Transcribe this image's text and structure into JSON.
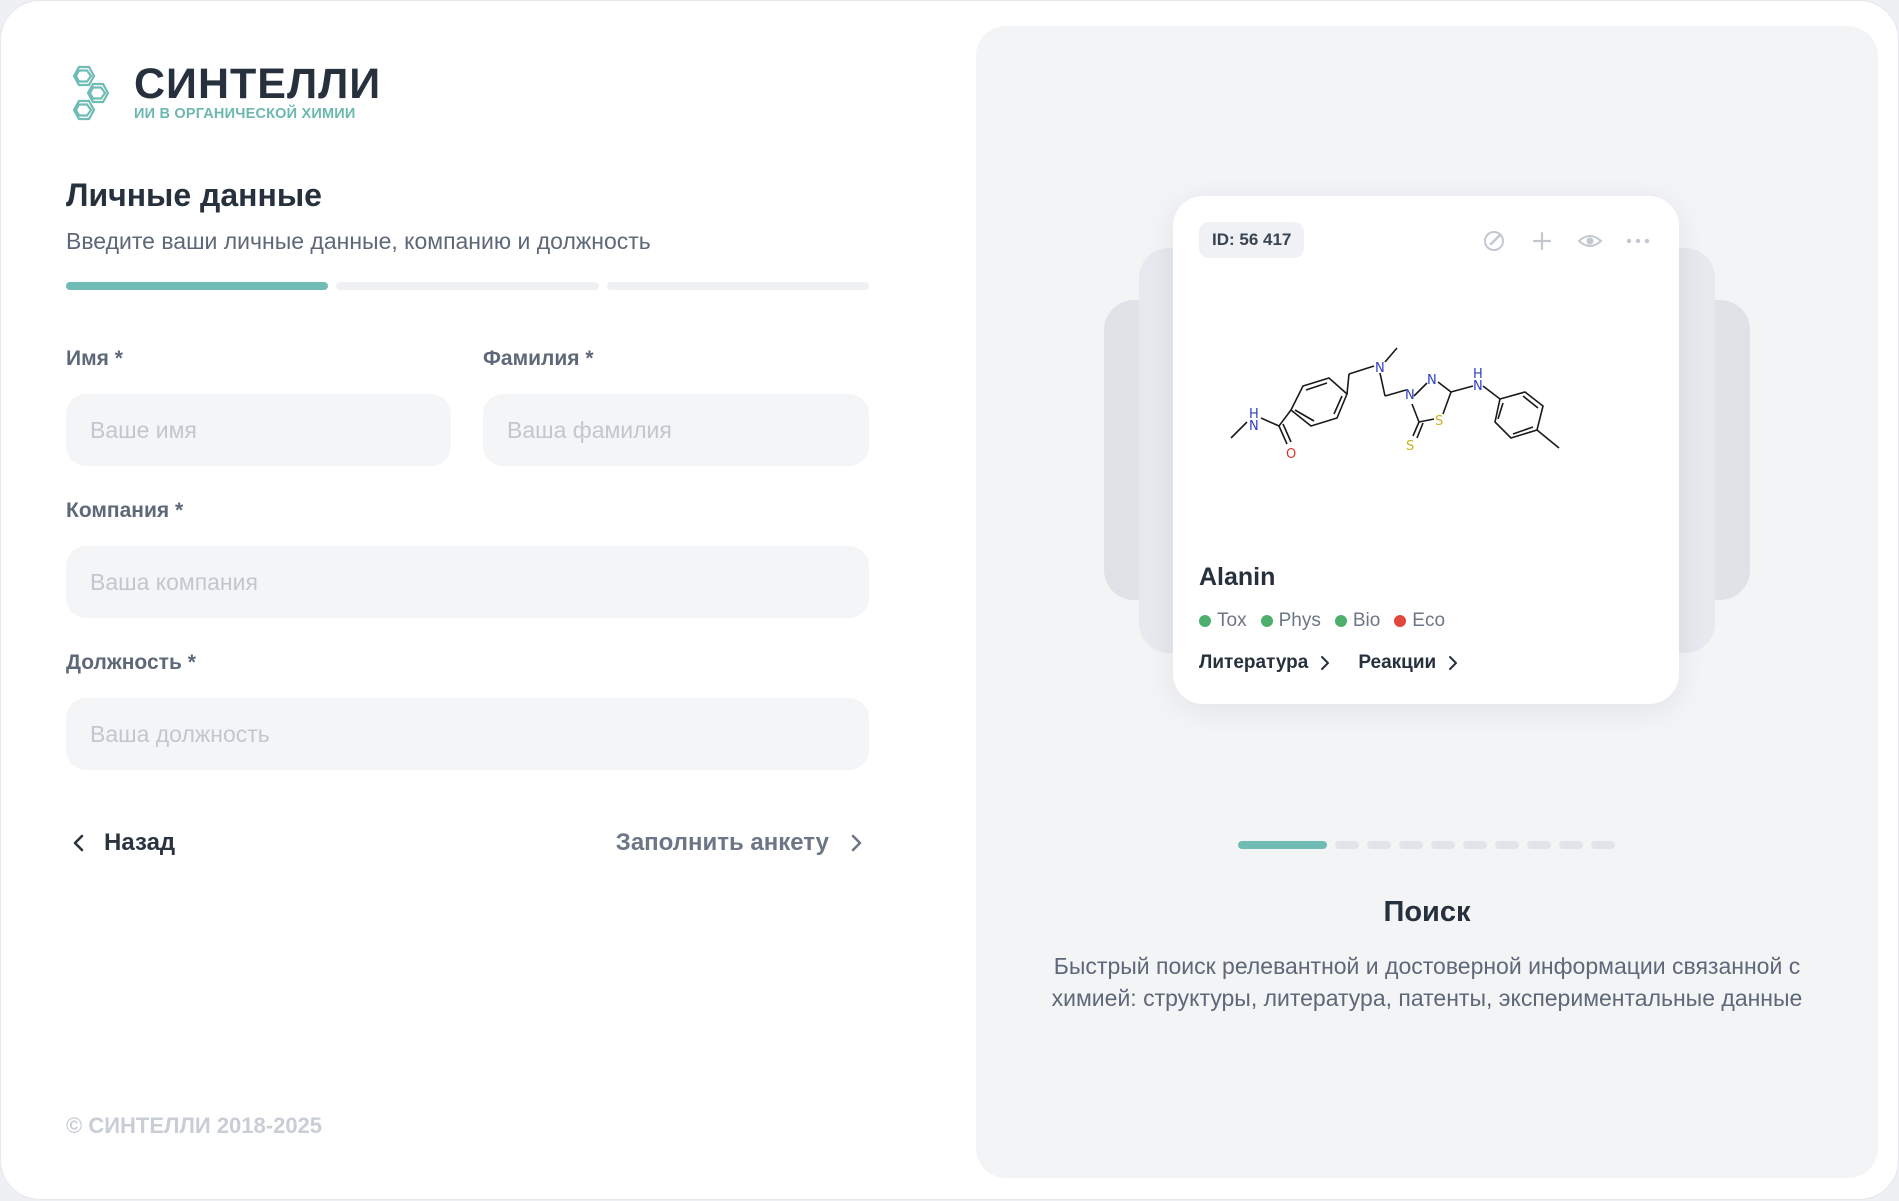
{
  "brand": {
    "name": "СИНТЕЛЛИ",
    "tagline": "ИИ В ОРГАНИЧЕСКОЙ ХИМИИ",
    "accent_color": "#6fbcb5"
  },
  "form": {
    "title": "Личные данные",
    "subtitle": "Введите ваши личные данные, компанию и должность",
    "step_progress": {
      "current": 1,
      "total": 3
    },
    "fields": {
      "first_name": {
        "label": "Имя *",
        "placeholder": "Ваше имя",
        "value": ""
      },
      "last_name": {
        "label": "Фамилия *",
        "placeholder": "Ваша фамилия",
        "value": ""
      },
      "company": {
        "label": "Компания *",
        "placeholder": "Ваша компания",
        "value": ""
      },
      "position": {
        "label": "Должность *",
        "placeholder": "Ваша должность",
        "value": ""
      }
    },
    "back_label": "Назад",
    "next_label": "Заполнить анкету"
  },
  "footer": {
    "copyright": "© СИНТЕЛЛИ 2018-2025"
  },
  "showcase": {
    "card": {
      "id_label": "ID: 56 417",
      "actions": [
        "edit-icon",
        "plus-icon",
        "eye-icon",
        "more-icon"
      ],
      "name": "Alanin",
      "badges": [
        {
          "label": "Tox",
          "color": "#4caf6e"
        },
        {
          "label": "Phys",
          "color": "#4caf6e"
        },
        {
          "label": "Bio",
          "color": "#4caf6e"
        },
        {
          "label": "Eco",
          "color": "#e0483b"
        }
      ],
      "links": [
        {
          "label": "Литература"
        },
        {
          "label": "Реакции"
        }
      ],
      "atoms": {
        "nh_1": "H",
        "n_1": "N",
        "o_1": "O",
        "n_2": "N",
        "n_3": "N",
        "n_4": "N",
        "s_1": "S",
        "s_2": "S",
        "nh_2": "H",
        "n_5": "N"
      }
    },
    "carousel": {
      "current": 1,
      "total": 10
    },
    "feature_title": "Поиск",
    "feature_description": "Быстрый поиск релевантной и достоверной информации связанной с химией: структуры, литература, патенты, экспериментальные данные"
  }
}
